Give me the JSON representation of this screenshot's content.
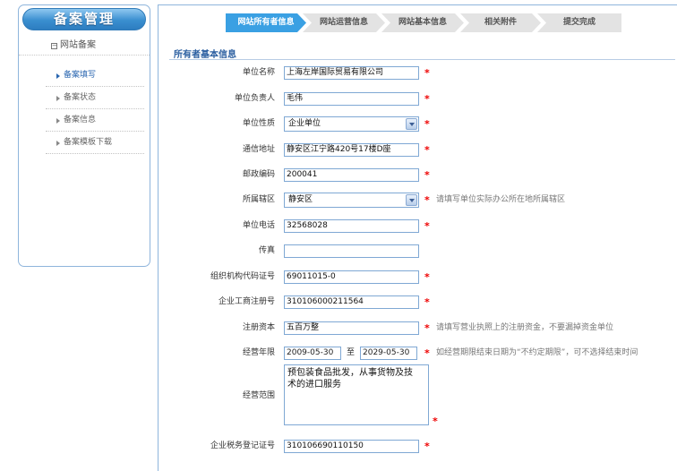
{
  "sidebar": {
    "title": "备案管理",
    "section": "网站备案",
    "section_toggle": "−",
    "items": [
      {
        "label": "备案填写",
        "active": true
      },
      {
        "label": "备案状态",
        "active": false
      },
      {
        "label": "备案信息",
        "active": false
      },
      {
        "label": "备案模板下载",
        "active": false
      }
    ]
  },
  "steps": [
    {
      "label": "网站所有者信息",
      "active": true
    },
    {
      "label": "网站运营信息",
      "active": false
    },
    {
      "label": "网站基本信息",
      "active": false
    },
    {
      "label": "相关附件",
      "active": false
    },
    {
      "label": "提交完成",
      "active": false
    }
  ],
  "form": {
    "section_title": "所有者基本信息",
    "required_mark": "*",
    "fields": {
      "unit_name": {
        "label": "单位名称",
        "value": "上海左岸国际贸易有限公司"
      },
      "unit_leader": {
        "label": "单位负责人",
        "value": "毛伟"
      },
      "unit_nature": {
        "label": "单位性质",
        "value": "企业单位"
      },
      "address": {
        "label": "通信地址",
        "value": "静安区江宁路420号17楼D座"
      },
      "postcode": {
        "label": "邮政编码",
        "value": "200041"
      },
      "district": {
        "label": "所属辖区",
        "value": "静安区",
        "hint": "请填写单位实际办公所在地所属辖区"
      },
      "phone": {
        "label": "单位电话",
        "value": "32568028"
      },
      "fax": {
        "label": "传真",
        "value": ""
      },
      "org_code": {
        "label": "组织机构代码证号",
        "value": "69011015-0"
      },
      "business_reg": {
        "label": "企业工商注册号",
        "value": "310106000211564"
      },
      "capital": {
        "label": "注册资本",
        "value": "五百万整",
        "hint": "请填写营业执照上的注册资金，不要漏掉资金单位"
      },
      "term": {
        "label": "经营年限",
        "from": "2009-05-30",
        "to_word": "至",
        "to": "2029-05-30",
        "hint": "如经营期限结束日期为“不约定期限”，可不选择结束时间"
      },
      "scope": {
        "label": "经营范围",
        "value": "预包装食品批发，从事货物及技\n术的进口服务"
      },
      "tax_reg": {
        "label": "企业税务登记证号",
        "value": "310106690110150"
      }
    }
  },
  "colors": {
    "accent": "#3aa0e3",
    "required": "#ee0000",
    "border": "#7fa8d4"
  }
}
